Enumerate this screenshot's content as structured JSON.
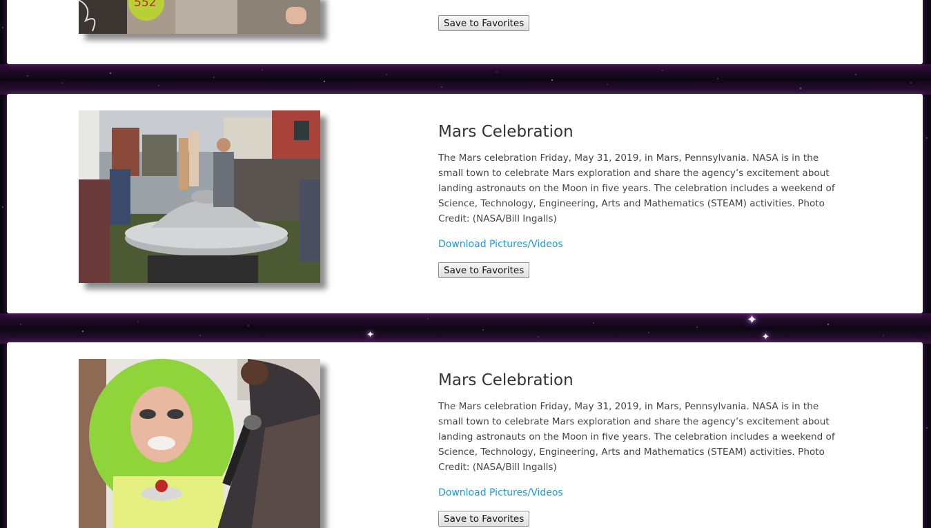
{
  "page": {
    "background": "#0b0612",
    "card_background": "#ffffff",
    "link_color": "#1a9ad6"
  },
  "cards": [
    {
      "title": "",
      "description": "",
      "link_label": "",
      "favorite_label": "Save to Favorites",
      "image_label": "552"
    },
    {
      "title": "Mars Celebration",
      "description": "The Mars celebration Friday, May 31, 2019, in Mars, Pennsylvania. NASA is in the small town to celebrate Mars exploration and share the agency’s excitement about landing astronauts on the Moon in five years. The celebration includes a weekend of Science, Technology, Engineering, Arts and Mathematics (STEAM) activities. Photo Credit: (NASA/Bill Ingalls)",
      "link_label": "Download Pictures/Videos",
      "favorite_label": "Save to Favorites"
    },
    {
      "title": "Mars Celebration",
      "description": "The Mars celebration Friday, May 31, 2019, in Mars, Pennsylvania. NASA is in the small town to celebrate Mars exploration and share the agency’s excitement about landing astronauts on the Moon in five years. The celebration includes a weekend of Science, Technology, Engineering, Arts and Mathematics (STEAM) activities. Photo Credit: (NASA/Bill Ingalls)",
      "link_label": "Download Pictures/Videos",
      "favorite_label": "Save to Favorites"
    }
  ]
}
